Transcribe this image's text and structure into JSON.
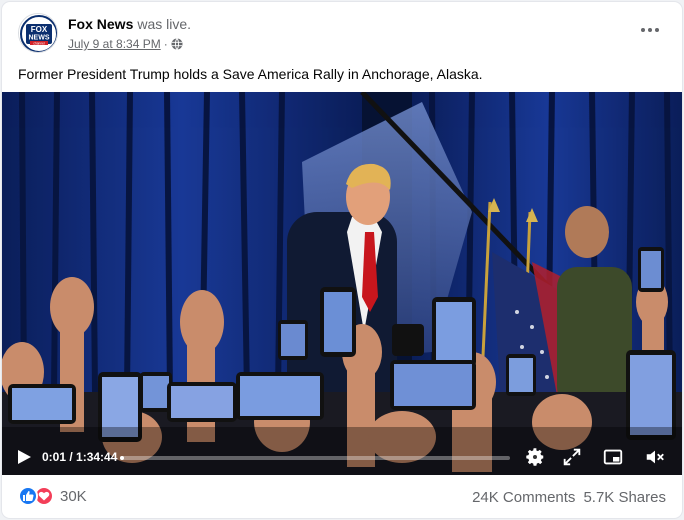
{
  "post": {
    "author": "Fox News",
    "status": "was live.",
    "timestamp": "July 9 at 8:34 PM",
    "separator": "·",
    "caption": "Former President Trump holds a Save America Rally in Anchorage, Alaska.",
    "logo_text_top": "FOX",
    "logo_text_bottom": "NEWS",
    "logo_sub": "channel"
  },
  "video": {
    "current_time": "0:01",
    "duration": "1:34:44",
    "time_display": "0:01 / 1:34:44",
    "progress": 0.01
  },
  "footer": {
    "reaction_count": "30K",
    "comments": "24K Comments",
    "shares": "5.7K Shares"
  },
  "colors": {
    "like_blue": "#1877f2",
    "love_red": "#f33e58",
    "fox_navy": "#0a2e6e",
    "fox_red": "#d12128"
  }
}
